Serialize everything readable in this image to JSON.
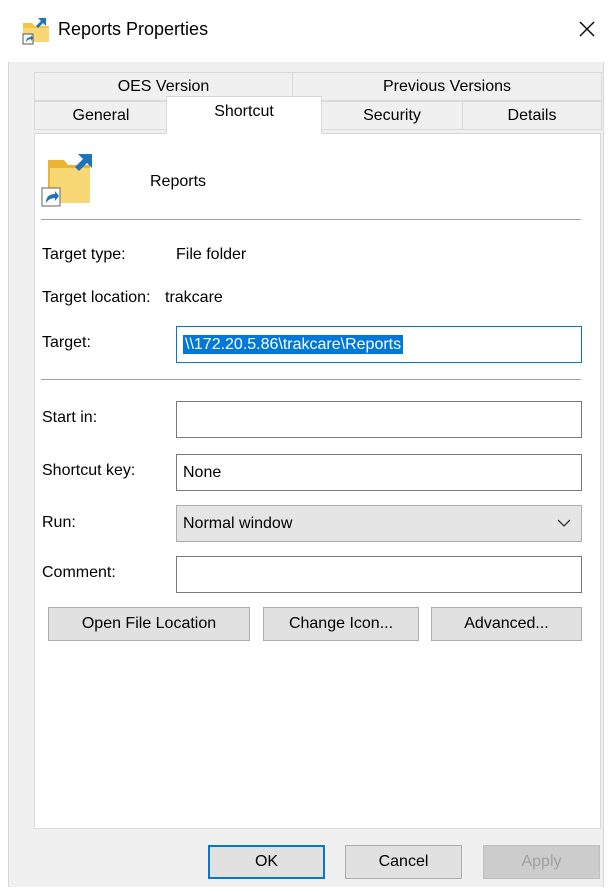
{
  "window": {
    "title": "Reports Properties",
    "close_label": "✕"
  },
  "tabs_top": [
    {
      "label": "OES Version"
    },
    {
      "label": "Previous Versions"
    }
  ],
  "tabs_bottom": [
    {
      "label": "General"
    },
    {
      "label": "Shortcut"
    },
    {
      "label": "Security"
    },
    {
      "label": "Details"
    }
  ],
  "shortcut": {
    "name": "Reports",
    "target_type_label": "Target type:",
    "target_type_value": "File folder",
    "target_location_label": "Target location:",
    "target_location_value": "trakcare",
    "target_label": "Target:",
    "target_value": "\\\\172.20.5.86\\trakcare\\Reports",
    "start_in_label": "Start in:",
    "start_in_value": "",
    "shortcut_key_label": "Shortcut key:",
    "shortcut_key_value": "None",
    "run_label": "Run:",
    "run_value": "Normal window",
    "comment_label": "Comment:",
    "comment_value": "",
    "open_file_location_label": "Open File Location",
    "change_icon_label": "Change Icon...",
    "advanced_label": "Advanced..."
  },
  "footer": {
    "ok_label": "OK",
    "cancel_label": "Cancel",
    "apply_label": "Apply"
  },
  "colors": {
    "accent": "#0078d7",
    "folder": "#f4c542",
    "shortcut_arrow": "#1e73be"
  }
}
